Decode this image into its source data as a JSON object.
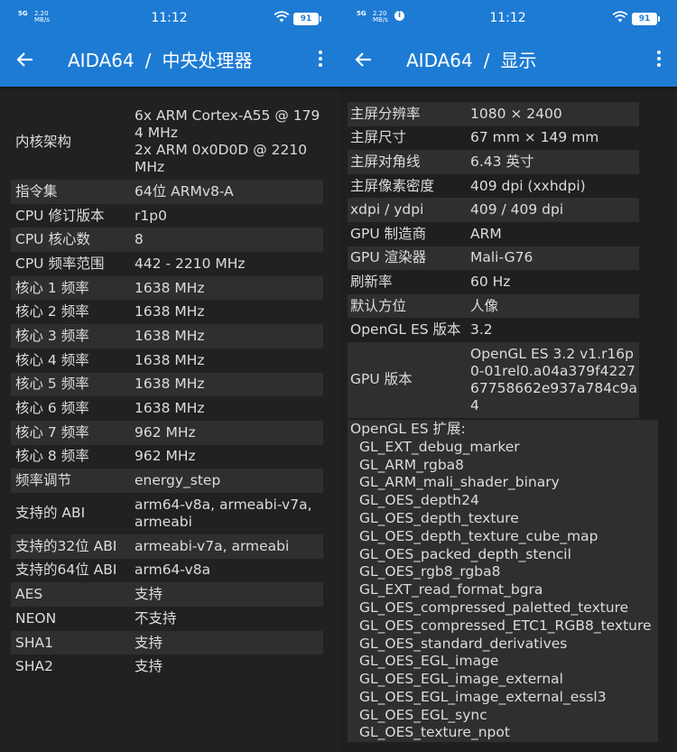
{
  "left": {
    "status": {
      "net": "5G",
      "speed_value": "2.20",
      "speed_unit": "MB/s",
      "time": "11:12",
      "battery": "91"
    },
    "appbar": {
      "app": "AIDA64",
      "sep": "/",
      "page": "中央处理器"
    },
    "rows": [
      {
        "label": "内核架构",
        "value": "6x ARM Cortex-A55 @ 1794 MHz\n2x ARM 0x0D0D @ 2210 MHz"
      },
      {
        "label": "指令集",
        "value": "64位 ARMv8-A"
      },
      {
        "label": "CPU 修订版本",
        "value": "r1p0"
      },
      {
        "label": "CPU 核心数",
        "value": "8"
      },
      {
        "label": "CPU 频率范围",
        "value": "442 - 2210 MHz"
      },
      {
        "label": "核心 1 频率",
        "value": "1638 MHz"
      },
      {
        "label": "核心 2 频率",
        "value": "1638 MHz"
      },
      {
        "label": "核心 3 频率",
        "value": "1638 MHz"
      },
      {
        "label": "核心 4 频率",
        "value": "1638 MHz"
      },
      {
        "label": "核心 5 频率",
        "value": "1638 MHz"
      },
      {
        "label": "核心 6 频率",
        "value": "1638 MHz"
      },
      {
        "label": "核心 7 频率",
        "value": "962 MHz"
      },
      {
        "label": "核心 8 频率",
        "value": "962 MHz"
      },
      {
        "label": "频率调节",
        "value": "energy_step"
      },
      {
        "label": "支持的 ABI",
        "value": "arm64-v8a, armeabi-v7a, armeabi"
      },
      {
        "label": "支持的32位 ABI",
        "value": "armeabi-v7a, armeabi"
      },
      {
        "label": "支持的64位 ABI",
        "value": "arm64-v8a"
      },
      {
        "label": "AES",
        "value": "支持"
      },
      {
        "label": "NEON",
        "value": "不支持"
      },
      {
        "label": "SHA1",
        "value": "支持"
      },
      {
        "label": "SHA2",
        "value": "支持"
      }
    ]
  },
  "right": {
    "status": {
      "net": "5G",
      "speed_value": "2.20",
      "speed_unit": "MB/s",
      "time": "11:12",
      "battery": "91"
    },
    "appbar": {
      "app": "AIDA64",
      "sep": "/",
      "page": "显示"
    },
    "rows": [
      {
        "label": "主屏分辨率",
        "value": "1080 × 2400"
      },
      {
        "label": "主屏尺寸",
        "value": "67 mm × 149 mm"
      },
      {
        "label": "主屏对角线",
        "value": "6.43 英寸"
      },
      {
        "label": "主屏像素密度",
        "value": "409 dpi (xxhdpi)"
      },
      {
        "label": "xdpi / ydpi",
        "value": "409 / 409 dpi"
      },
      {
        "label": "GPU 制造商",
        "value": "ARM"
      },
      {
        "label": "GPU 渲染器",
        "value": "Mali-G76"
      },
      {
        "label": "刷新率",
        "value": "60 Hz"
      },
      {
        "label": "默认方位",
        "value": "人像"
      },
      {
        "label": "OpenGL ES 版本",
        "value": "3.2"
      },
      {
        "label": "GPU 版本",
        "value": "OpenGL ES 3.2 v1.r16p0-01rel0.a04a379f422767758662e937a784c9a4"
      }
    ],
    "ext_title": "OpenGL ES 扩展:",
    "extensions": [
      "GL_EXT_debug_marker",
      "GL_ARM_rgba8",
      "GL_ARM_mali_shader_binary",
      "GL_OES_depth24",
      "GL_OES_depth_texture",
      "GL_OES_depth_texture_cube_map",
      "GL_OES_packed_depth_stencil",
      "GL_OES_rgb8_rgba8",
      "GL_EXT_read_format_bgra",
      "GL_OES_compressed_paletted_texture",
      "GL_OES_compressed_ETC1_RGB8_texture",
      "GL_OES_standard_derivatives",
      "GL_OES_EGL_image",
      "GL_OES_EGL_image_external",
      "GL_OES_EGL_image_external_essl3",
      "GL_OES_EGL_sync",
      "GL_OES_texture_npot"
    ]
  },
  "colors": {
    "appbar": "#1d7bd4",
    "background": "#212121",
    "row_alt": "#2f2f2f",
    "text": "#dcdcdc"
  },
  "icons": {
    "back": "arrow-left-icon",
    "menu": "more-vert-icon",
    "wifi": "wifi-icon",
    "battery": "battery-icon",
    "info": "info-icon"
  }
}
